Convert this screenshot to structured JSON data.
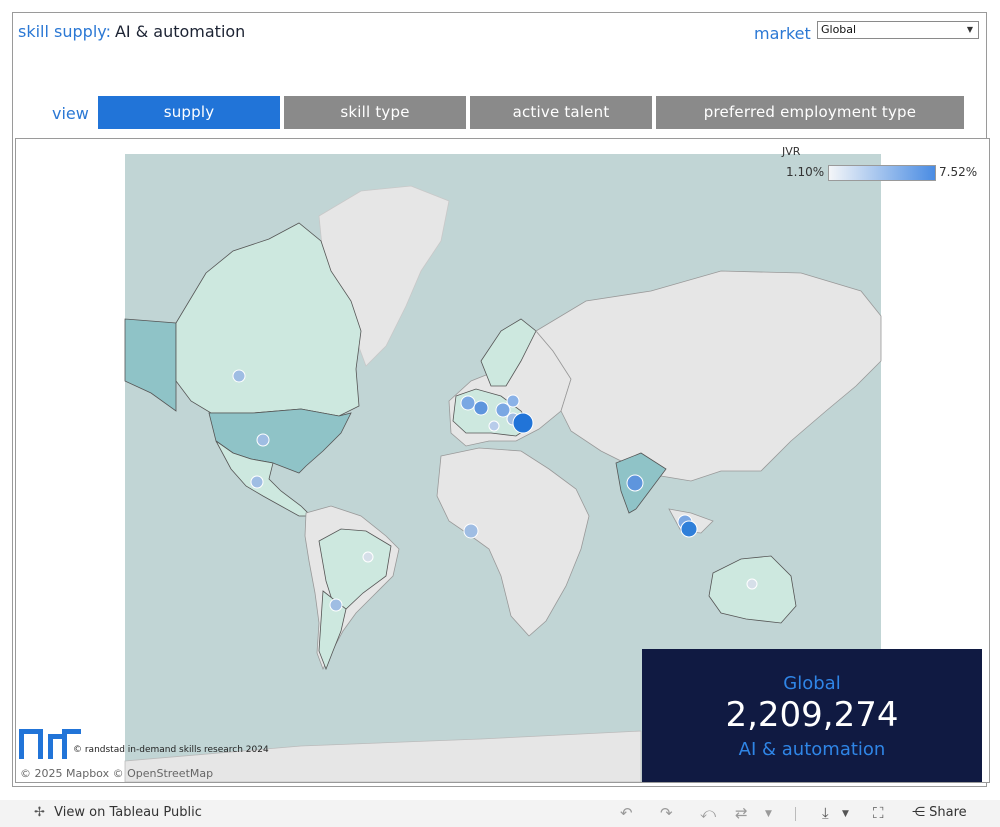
{
  "header": {
    "title_label": "skill supply:",
    "title_value": "AI & automation",
    "market_label": "market",
    "market_selected": "Global"
  },
  "view": {
    "label": "view",
    "tabs": [
      {
        "label": "supply",
        "active": true
      },
      {
        "label": "skill type",
        "active": false
      },
      {
        "label": "active talent",
        "active": false
      },
      {
        "label": "preferred employment type",
        "active": false
      }
    ]
  },
  "legend": {
    "title": "JVR",
    "min": "1.10%",
    "max": "7.52%",
    "color_low": "#f4f6f8",
    "color_high": "#4a8ce3"
  },
  "summary": {
    "market": "Global",
    "count": "2,209,274",
    "skill": "AI & automation"
  },
  "credit": "© randstad in-demand skills research 2024",
  "map_attribution": "© 2025 Mapbox  © OpenStreetMap",
  "footer": {
    "view_on": "View on Tableau Public",
    "share": "Share"
  },
  "colors": {
    "accent": "#2b78d4",
    "active_tab": "#2174d8",
    "inactive_tab": "#8a8a8a",
    "summary_bg": "#101a42",
    "ocean": "#c1d5d5",
    "land": "#e6e6e6",
    "highlight_land": "#cde8df"
  }
}
